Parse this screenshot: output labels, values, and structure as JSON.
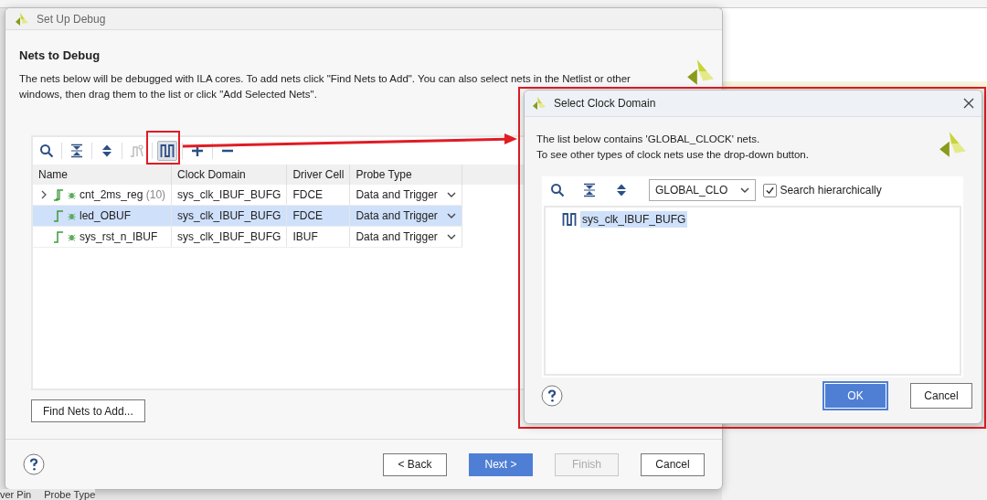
{
  "background": {
    "header_texts": [
      "ver Pin",
      "Probe Type"
    ]
  },
  "dialog": {
    "title": "Set Up Debug",
    "heading": "Nets to Debug",
    "description_lines": [
      "The nets below will be debugged with ILA cores. To add nets click \"Find Nets to Add\". You can also select nets in the Netlist or other",
      "windows, then drag them to the list or click \"Add Selected Nets\"."
    ],
    "toolbar": [
      {
        "kind": "search",
        "disabled": false,
        "pressed": false
      },
      {
        "kind": "collapse",
        "disabled": false,
        "pressed": false
      },
      {
        "kind": "expand",
        "disabled": false,
        "pressed": false
      },
      {
        "kind": "schematic",
        "disabled": true,
        "pressed": false
      },
      {
        "kind": "clock",
        "disabled": false,
        "pressed": true
      },
      {
        "kind": "add",
        "disabled": false,
        "pressed": false
      },
      {
        "kind": "remove",
        "disabled": false,
        "pressed": false
      }
    ],
    "table": {
      "columns": [
        "Name",
        "Clock Domain",
        "Driver Cell",
        "Probe Type"
      ],
      "rows": [
        {
          "kind": "bus",
          "expanded": false,
          "name": "cnt_2ms_reg",
          "count": "(10)",
          "clock_domain": "sys_clk_IBUF_BUFG",
          "driver_cell": "FDCE",
          "probe_type": "Data and Trigger",
          "selected": false
        },
        {
          "kind": "net",
          "name": "led_OBUF",
          "clock_domain": "sys_clk_IBUF_BUFG",
          "driver_cell": "FDCE",
          "probe_type": "Data and Trigger",
          "selected": true
        },
        {
          "kind": "net",
          "name": "sys_rst_n_IBUF",
          "clock_domain": "sys_clk_IBUF_BUFG",
          "driver_cell": "IBUF",
          "probe_type": "Data and Trigger",
          "selected": false
        }
      ]
    },
    "find_button": "Find Nets to Add...",
    "buttons": [
      {
        "label": "< Back",
        "default": false,
        "disabled": false
      },
      {
        "label": "Next >",
        "default": true,
        "disabled": false
      },
      {
        "label": "Finish",
        "default": false,
        "disabled": true
      },
      {
        "label": "Cancel",
        "default": false,
        "disabled": false
      }
    ]
  },
  "clock_dialog": {
    "title": "Select Clock Domain",
    "description_lines": [
      "The list below contains 'GLOBAL_CLOCK' nets.",
      "To see other types of clock nets use the drop-down button."
    ],
    "type_dropdown": "GLOBAL_CLO",
    "search_checkbox": {
      "label": "Search hierarchically",
      "checked": true
    },
    "items": [
      {
        "name": "sys_clk_IBUF_BUFG",
        "selected": true
      }
    ],
    "buttons": [
      {
        "label": "OK",
        "default": true,
        "disabled": false
      },
      {
        "label": "Cancel",
        "default": false,
        "disabled": false
      }
    ]
  }
}
